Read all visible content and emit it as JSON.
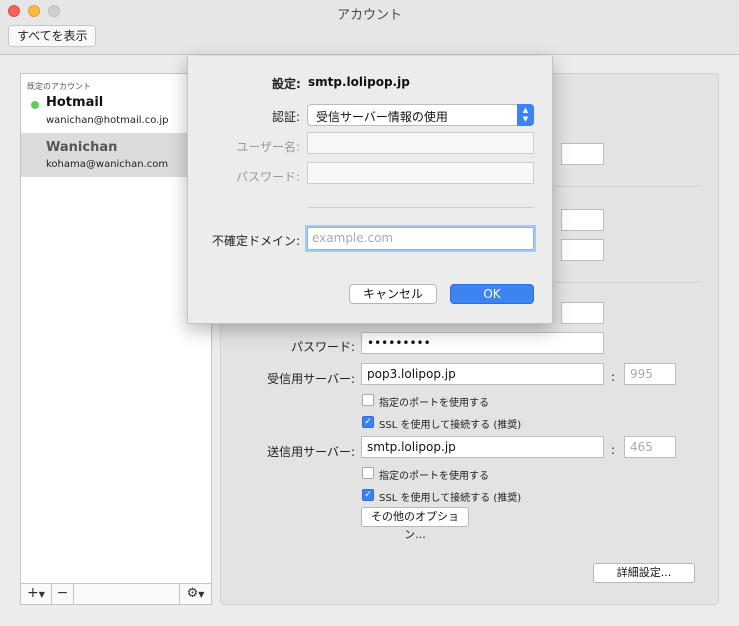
{
  "window": {
    "title": "アカウント"
  },
  "toolbar": {
    "show_all_label": "すべてを表示"
  },
  "sidebar": {
    "header": "既定のアカウント",
    "accounts": [
      {
        "name": "Hotmail",
        "email": "wanichan@hotmail.co.jp",
        "status_color": "#5ad25a"
      },
      {
        "name": "Wanichan",
        "email": "kohama@wanichan.com"
      }
    ],
    "footer": {
      "add_label": "+",
      "remove_label": "−",
      "gear_label": "⚙"
    }
  },
  "main": {
    "password_label": "パスワード:",
    "password_value": "•••••••••",
    "incoming_label": "受信用サーバー:",
    "incoming_value": "pop3.lolipop.jp",
    "incoming_port": "995",
    "incoming_custom_port_label": "指定のポートを使用する",
    "incoming_ssl_label": "SSL を使用して接続する (推奨)",
    "outgoing_label": "送信用サーバー:",
    "outgoing_value": "smtp.lolipop.jp",
    "outgoing_port": "465",
    "outgoing_custom_port_label": "指定のポートを使用する",
    "outgoing_ssl_label": "SSL を使用して接続する (推奨)",
    "more_options_label": "その他のオプション...",
    "advanced_label": "詳細設定..."
  },
  "sheet": {
    "title_label": "設定:",
    "title_value": "smtp.lolipop.jp",
    "auth_label": "認証:",
    "auth_value": "受信サーバー情報の使用",
    "username_label": "ユーザー名:",
    "password_label": "パスワード:",
    "domain_label": "不確定ドメイン:",
    "domain_placeholder": "example.com",
    "cancel_label": "キャンセル",
    "ok_label": "OK"
  },
  "colors": {
    "accent": "#3d84f2"
  }
}
